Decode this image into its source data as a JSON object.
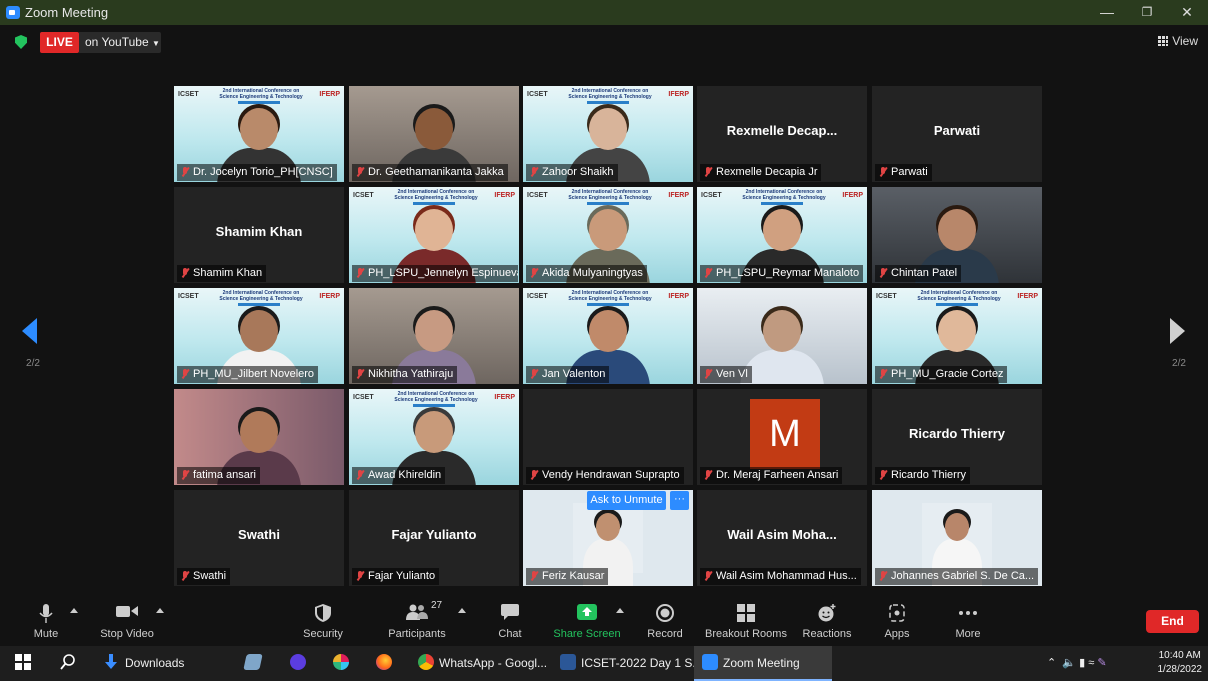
{
  "window": {
    "title": "Zoom Meeting"
  },
  "topbar": {
    "live": "LIVE",
    "platform": "on YouTube",
    "view": "View"
  },
  "nav": {
    "page_left": "2/2",
    "page_right": "2/2"
  },
  "tiles": [
    {
      "name": "Dr. Jocelyn Torio_PH[CNSC]",
      "display": "",
      "kind": "conf",
      "skin": "#b98a6a",
      "hair": "#2a1a10",
      "shirt": "#333"
    },
    {
      "name": "Dr. Geethamanikanta Jakka",
      "display": "",
      "kind": "room",
      "skin": "#8a5a3a",
      "hair": "#1a1a1a",
      "shirt": "#3a3a3a"
    },
    {
      "name": "Zahoor Shaikh",
      "display": "",
      "kind": "conf",
      "skin": "#d8b49a",
      "hair": "#3a2a1a",
      "shirt": "#444"
    },
    {
      "name": "Rexmelle Decapia Jr",
      "display": "Rexmelle  Decap...",
      "kind": "name"
    },
    {
      "name": "Parwati",
      "display": "Parwati",
      "kind": "name"
    },
    {
      "name": "Shamim Khan",
      "display": "Shamim Khan",
      "kind": "name"
    },
    {
      "name": "PH_LSPU_Jennelyn Espinueva",
      "display": "",
      "kind": "conf",
      "skin": "#e0b495",
      "hair": "#7a2a1a",
      "shirt": "#7a2a2a"
    },
    {
      "name": "Akida Mulyaningtyas",
      "display": "",
      "kind": "conf",
      "skin": "#c99a7a",
      "hair": "#6a6a5a",
      "shirt": "#6a6a5a"
    },
    {
      "name": "PH_LSPU_Reymar Manaloto",
      "display": "",
      "kind": "conf",
      "skin": "#d0a080",
      "hair": "#1a1a1a",
      "shirt": "#2a2a2a"
    },
    {
      "name": "Chintan Patel",
      "display": "",
      "kind": "dark",
      "skin": "#b8876a",
      "hair": "#2a1a10",
      "shirt": "#2a3a4a"
    },
    {
      "name": "PH_MU_Jilbert Novelero",
      "display": "",
      "kind": "conf",
      "skin": "#a8785a",
      "hair": "#1a1a1a",
      "shirt": "#f2f2f2"
    },
    {
      "name": "Nikhitha Yathiraju",
      "display": "",
      "kind": "room",
      "skin": "#c79a82",
      "hair": "#1a1a1a",
      "shirt": "#8a7a9a"
    },
    {
      "name": "Jan Valenton",
      "display": "",
      "kind": "conf",
      "skin": "#c08a6a",
      "hair": "#1a1a1a",
      "shirt": "#2a4a7a"
    },
    {
      "name": "Ven Vl",
      "display": "",
      "kind": "bright",
      "skin": "#c09a80",
      "hair": "#3a2a1a",
      "shirt": "#dfe6ef"
    },
    {
      "name": "PH_MU_Gracie Cortez",
      "display": "",
      "kind": "conf",
      "skin": "#e0b89a",
      "hair": "#1a1a1a",
      "shirt": "#2a2a2a"
    },
    {
      "name": "fatima ansari",
      "display": "",
      "kind": "pink",
      "skin": "#b07a5a",
      "hair": "#1a1a1a",
      "shirt": "#5a3a4a"
    },
    {
      "name": "Awad Khireldin",
      "display": "",
      "kind": "conf",
      "skin": "#c89a7a",
      "hair": "#3a3a3a",
      "shirt": "#2a2a2a"
    },
    {
      "name": "Vendy Hendrawan Suprapto",
      "display": "",
      "kind": "blank"
    },
    {
      "name": "Dr. Meraj Farheen Ansari",
      "display": "",
      "kind": "avatar",
      "initial": "M"
    },
    {
      "name": "Ricardo Thierry",
      "display": "Ricardo Thierry",
      "kind": "name"
    },
    {
      "name": "Swathi",
      "display": "Swathi",
      "kind": "name"
    },
    {
      "name": "Fajar Yulianto",
      "display": "Fajar Yulianto",
      "kind": "name"
    },
    {
      "name": "Feriz Kausar",
      "display": "",
      "kind": "photo",
      "skin": "#c09070",
      "hair": "#1a1a1a",
      "shirt": "#f2f2f2"
    },
    {
      "name": "Wail Asim Mohammad Hus...",
      "display": "Wail Asim Moha...",
      "kind": "name"
    },
    {
      "name": "Johannes Gabriel S. De Ca...",
      "display": "",
      "kind": "photo",
      "skin": "#b8866a",
      "hair": "#1a1a1a",
      "shirt": "#f6f6f6"
    }
  ],
  "conference_banner": {
    "left": "ICSET",
    "title": "2nd International Conference on Science Engineering & Technology",
    "right": "IFERP"
  },
  "overlay": {
    "ask_unmute": "Ask to Unmute",
    "more": "···"
  },
  "toolbar": {
    "mute": "Mute",
    "stop_video": "Stop Video",
    "security": "Security",
    "participants": "Participants",
    "participants_count": "27",
    "chat": "Chat",
    "share_screen": "Share Screen",
    "record": "Record",
    "breakout_rooms": "Breakout Rooms",
    "reactions": "Reactions",
    "apps": "Apps",
    "more": "More",
    "end": "End"
  },
  "taskbar": {
    "downloads": "Downloads",
    "whatsapp": "WhatsApp - Googl...",
    "word_doc": "ICSET-2022 Day 1 S...",
    "zoom": "Zoom Meeting",
    "time": "10:40 AM",
    "date": "1/28/2022"
  },
  "colors": {
    "accent": "#2d8cff",
    "live_red": "#e02828",
    "share_green": "#23c35e",
    "titlebar": "#2a3b1e"
  }
}
